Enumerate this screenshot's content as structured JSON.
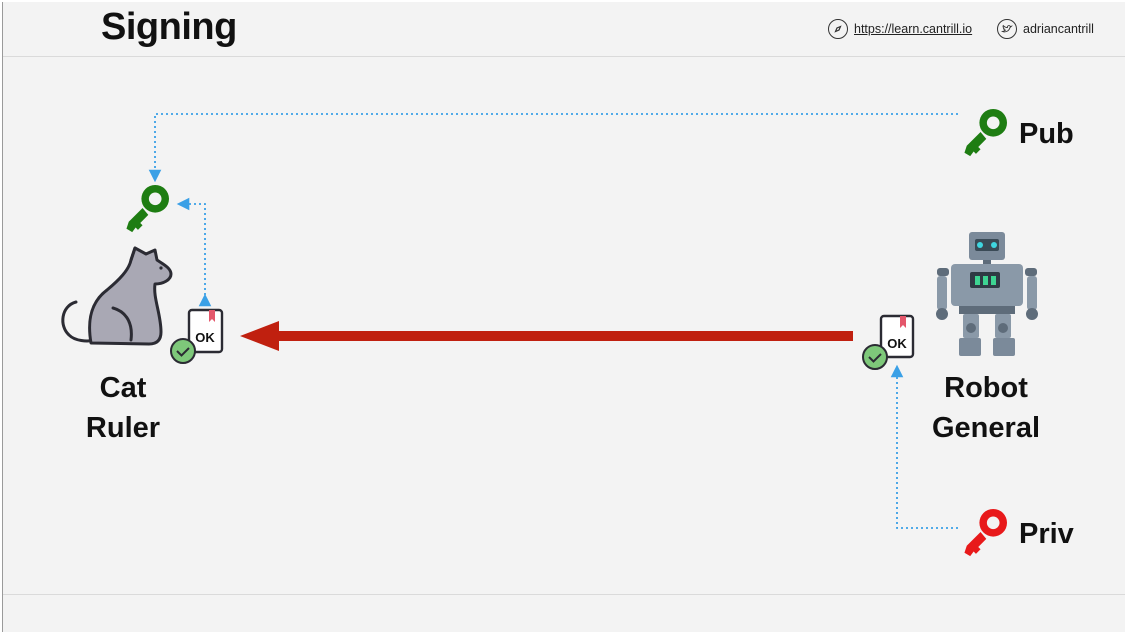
{
  "header": {
    "title": "Signing",
    "website": "https://learn.cantrill.io",
    "twitter": "adriancantrill"
  },
  "actors": {
    "cat": {
      "line1": "Cat",
      "line2": "Ruler"
    },
    "robot": {
      "line1": "Robot",
      "line2": "General"
    }
  },
  "keys": {
    "public_label": "Pub",
    "private_label": "Priv"
  },
  "documents": {
    "stamp_text": "OK"
  },
  "colors": {
    "public_key": "#1e7d12",
    "private_key": "#e8191a",
    "message_arrow": "#c0200f",
    "dotted_arrow": "#3aa0e6",
    "check_badge": "#7ec87a"
  },
  "icons": [
    "compass-icon",
    "twitter-bird-icon",
    "cat-icon",
    "robot-icon",
    "key-icon",
    "signed-document-icon",
    "check-badge-icon"
  ]
}
